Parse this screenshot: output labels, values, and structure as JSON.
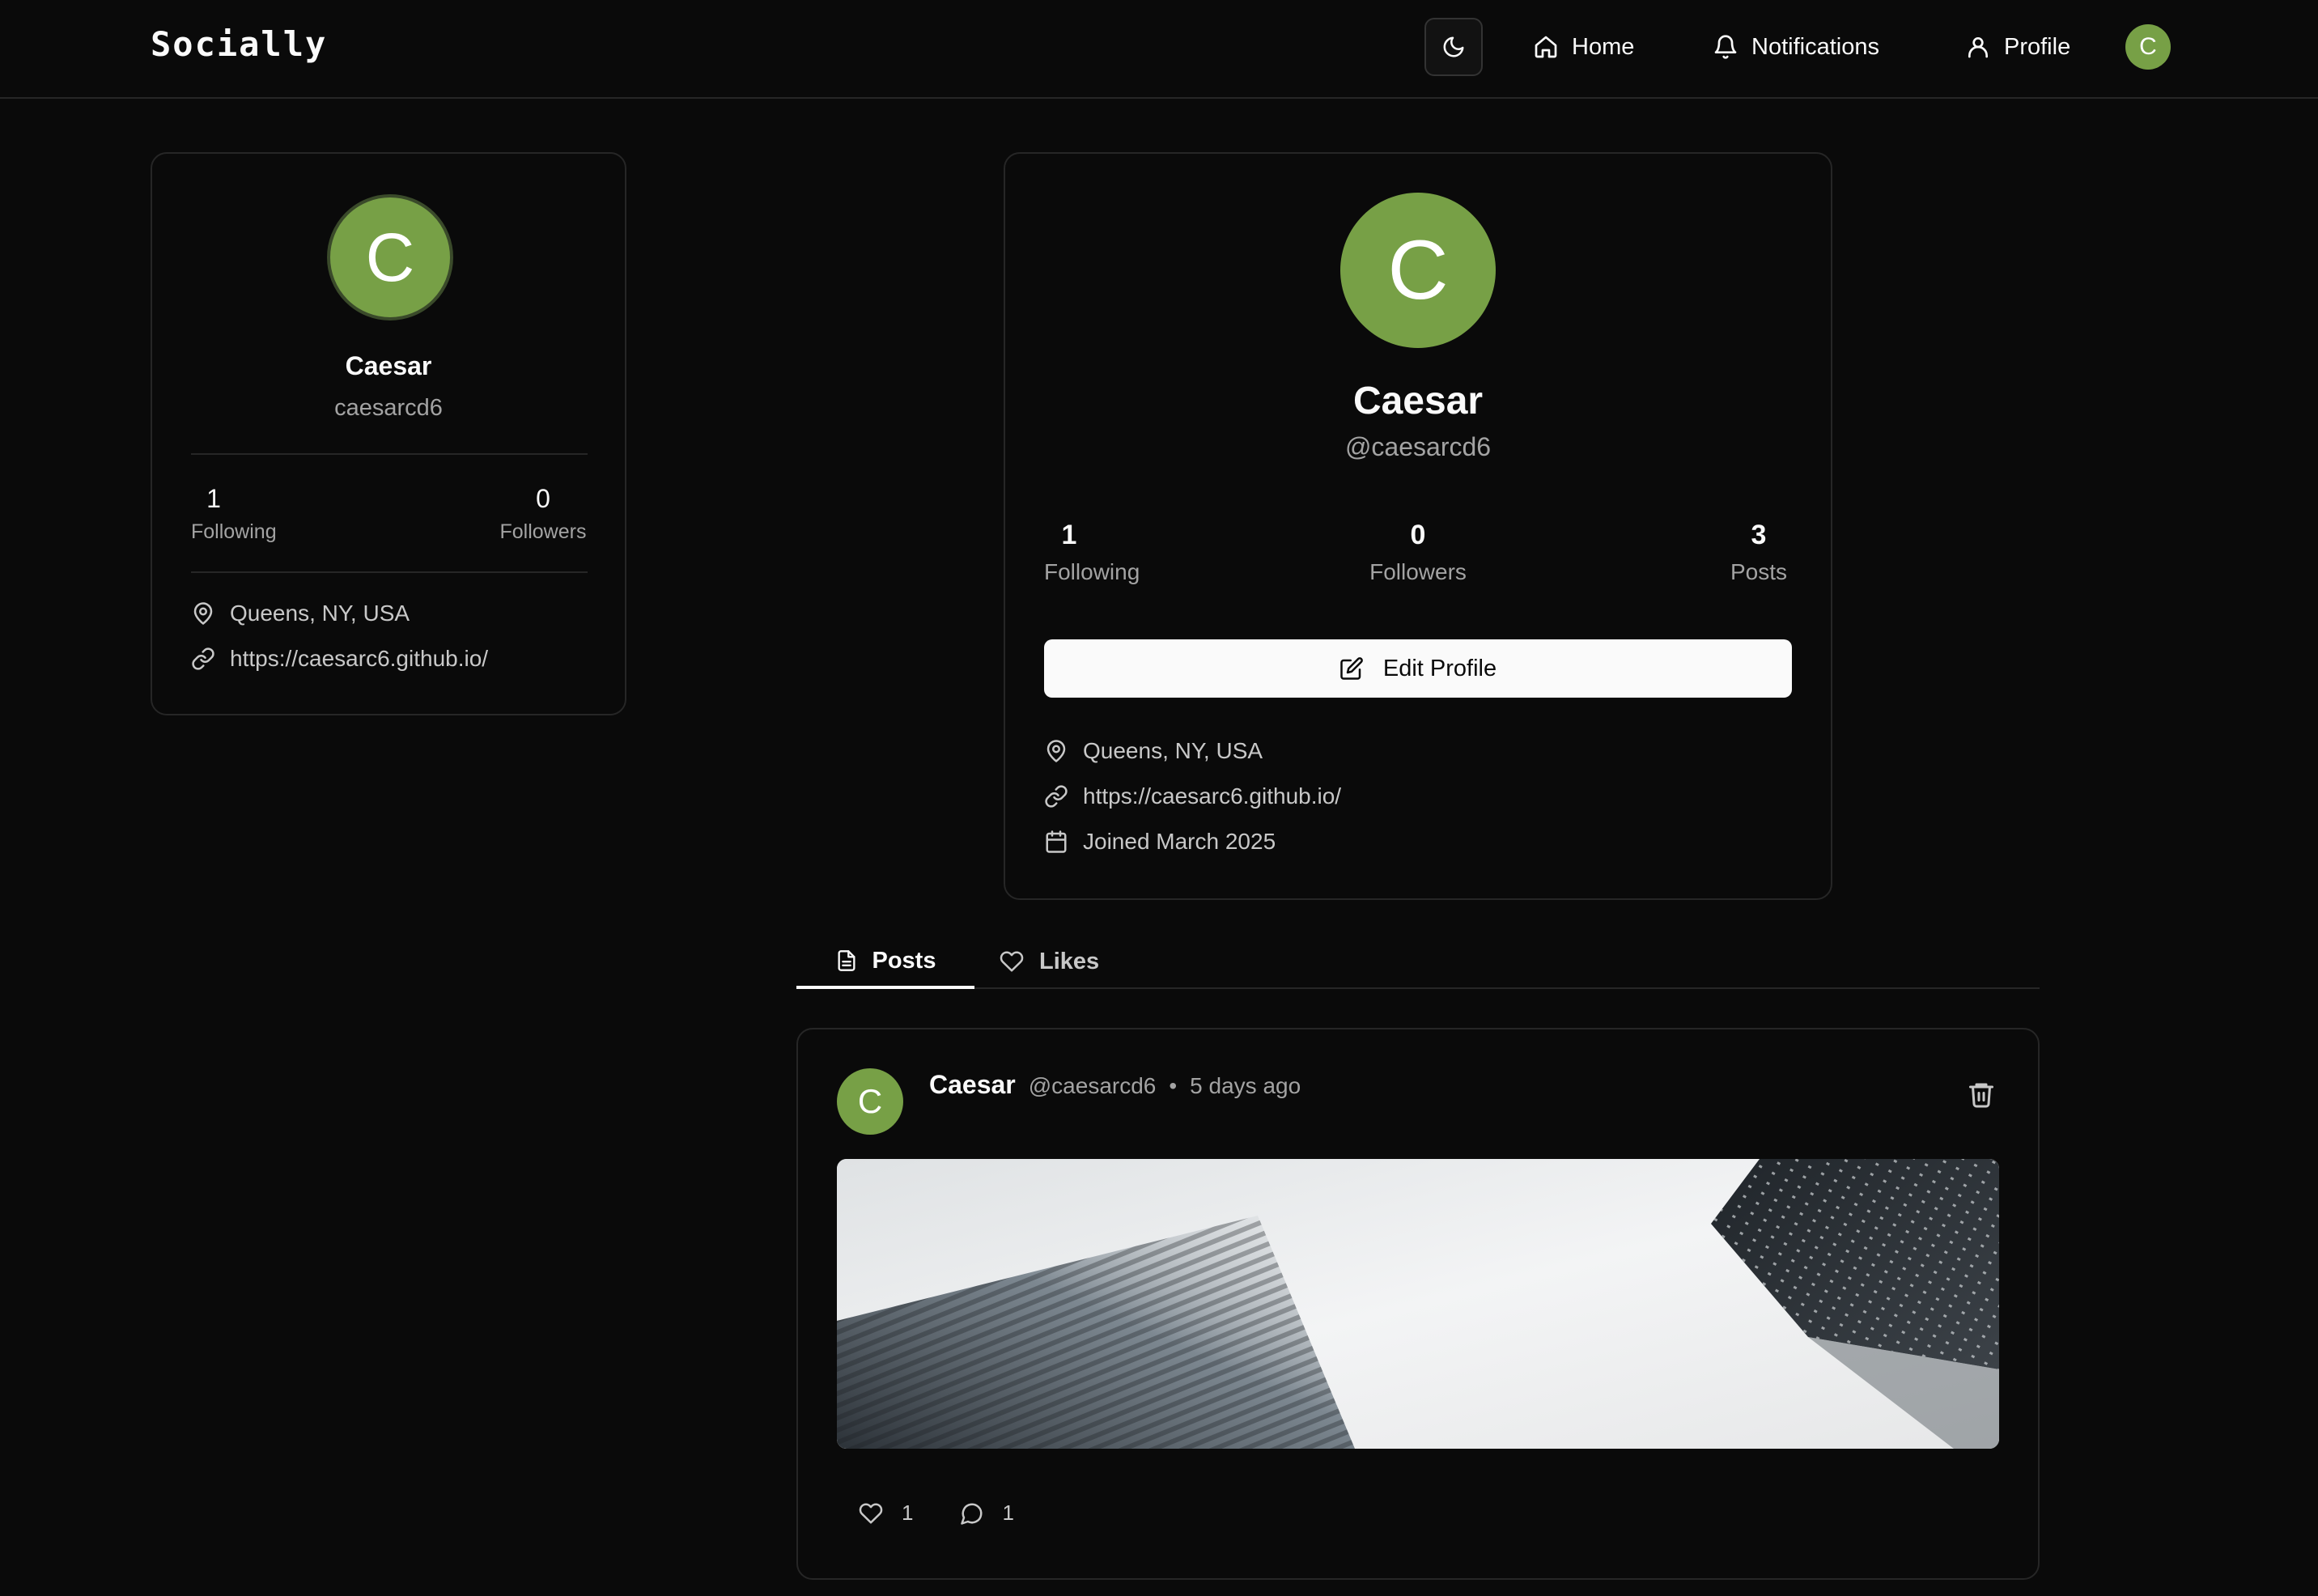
{
  "nav": {
    "brand": "Socially",
    "theme_icon": "moon-icon",
    "items": [
      {
        "label": "Home",
        "icon": "home-icon"
      },
      {
        "label": "Notifications",
        "icon": "bell-icon"
      },
      {
        "label": "Profile",
        "icon": "user-icon"
      }
    ],
    "avatar_initial": "C"
  },
  "sidebar": {
    "avatar_initial": "C",
    "name": "Caesar",
    "handle": "caesarcd6",
    "stats": [
      {
        "value": "1",
        "label": "Following"
      },
      {
        "value": "0",
        "label": "Followers"
      }
    ],
    "location": "Queens, NY, USA",
    "website": "https://caesarc6.github.io/"
  },
  "profile": {
    "avatar_initial": "C",
    "name": "Caesar",
    "handle": "@caesarcd6",
    "stats": [
      {
        "value": "1",
        "label": "Following"
      },
      {
        "value": "0",
        "label": "Followers"
      },
      {
        "value": "3",
        "label": "Posts"
      }
    ],
    "edit_label": "Edit Profile",
    "location": "Queens, NY, USA",
    "website": "https://caesarc6.github.io/",
    "joined": "Joined March 2025"
  },
  "tabs": [
    {
      "label": "Posts",
      "icon": "document-icon",
      "active": true
    },
    {
      "label": "Likes",
      "icon": "heart-icon",
      "active": false
    }
  ],
  "post": {
    "avatar_initial": "C",
    "author": "Caesar",
    "handle": "@caesarcd6",
    "separator": "•",
    "time": "5 days ago",
    "likes": "1",
    "comments": "1"
  },
  "colors": {
    "background": "#0a0a0a",
    "border": "#262626",
    "avatar_green": "#77a046",
    "text_primary": "#fafafa",
    "text_muted": "#a3a3a3"
  }
}
